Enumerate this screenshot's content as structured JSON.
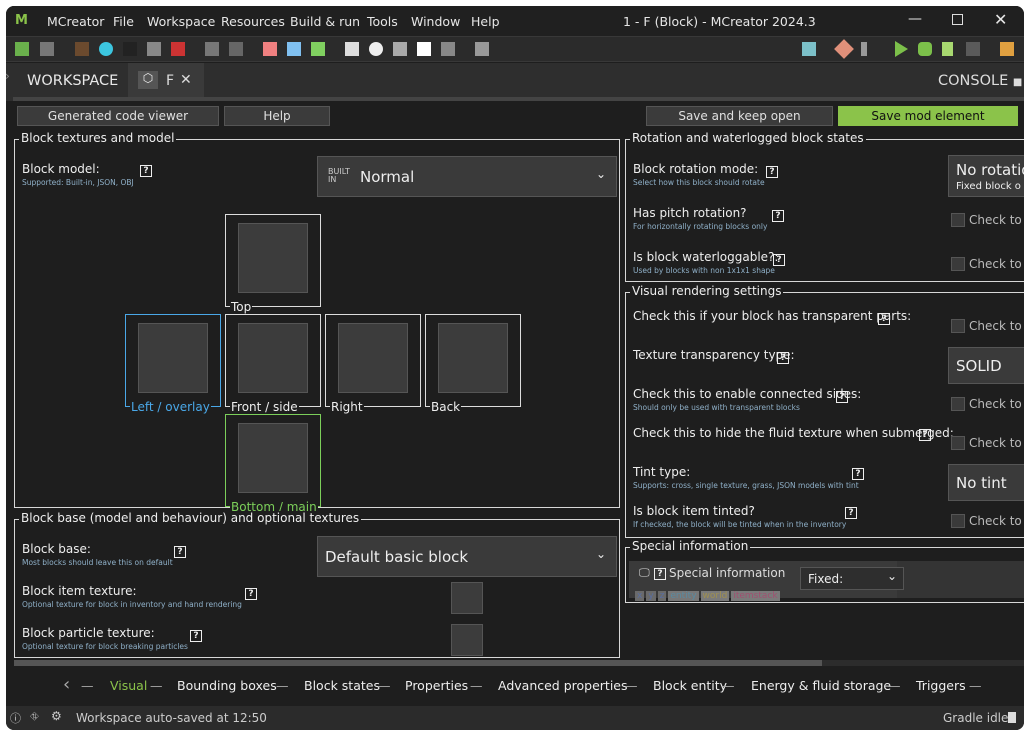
{
  "window": {
    "title": "1 - F (Block) - MCreator 2024.3",
    "menu": [
      "MCreator",
      "File",
      "Workspace",
      "Resources",
      "Build & run",
      "Tools",
      "Window",
      "Help"
    ]
  },
  "tabs": {
    "workspace": "WORKSPACE",
    "active": "F",
    "console": "CONSOLE"
  },
  "actions": {
    "code_viewer": "Generated code viewer",
    "help": "Help",
    "save_keep_open": "Save and keep open",
    "save": "Save mod element"
  },
  "textures": {
    "title": "Block textures and model",
    "model_label": "Block model:",
    "model_sub": "Supported: Built-in, JSON, OBJ",
    "model_badge": "BUILT IN",
    "model_value": "Normal",
    "slots": {
      "top": "Top",
      "left": "Left / overlay",
      "front": "Front / side",
      "right": "Right",
      "back": "Back",
      "bottom": "Bottom / main"
    }
  },
  "base": {
    "title": "Block base (model and behaviour) and optional textures",
    "base_label": "Block base:",
    "base_sub": "Most blocks should leave this on default",
    "base_value": "Default basic block",
    "item_label": "Block item texture:",
    "item_sub": "Optional texture for block in inventory and hand rendering",
    "particle_label": "Block particle texture:",
    "particle_sub": "Optional texture for block breaking particles"
  },
  "rotation": {
    "title": "Rotation and waterlogged block states",
    "mode_label": "Block rotation mode:",
    "mode_sub": "Select how this block should rotate",
    "mode_value": "No rotatio",
    "mode_value_sub": "Fixed block o",
    "pitch_label": "Has pitch rotation?",
    "pitch_sub": "For horizontally rotating blocks only",
    "water_label": "Is block waterloggable?:",
    "water_sub": "Used by blocks with non 1x1x1 shape",
    "check": "Check to e"
  },
  "visual": {
    "title": "Visual rendering settings",
    "transparent_label": "Check this if your block has transparent parts:",
    "ttype_label": "Texture transparency type:",
    "ttype_value": "SOLID",
    "connected_label": "Check this to enable connected sides:",
    "connected_sub": "Should only be used with transparent blocks",
    "fluid_label": "Check this to hide the fluid texture when submerged:",
    "tint_label": "Tint type:",
    "tint_sub": "Supports: cross, single texture, grass, JSON models with tint",
    "tint_value": "No tint",
    "itemtint_label": "Is block item tinted?",
    "itemtint_sub": "If checked, the block will be tinted when in the inventory"
  },
  "special": {
    "title": "Special information",
    "label": "Special information",
    "tags": [
      "x",
      "y",
      "z",
      "entity",
      "world",
      "itemstack"
    ],
    "mode": "Fixed:"
  },
  "pages": [
    "Visual",
    "Bounding boxes",
    "Block states",
    "Properties",
    "Advanced properties",
    "Block entity",
    "Energy & fluid storage",
    "Triggers"
  ],
  "status": {
    "message": "Workspace auto-saved at 12:50",
    "gradle": "Gradle idle"
  },
  "colors": {
    "accent": "#8bc34a",
    "left_slot": "#4aa8e8",
    "bottom_slot": "#7ccf5a"
  }
}
